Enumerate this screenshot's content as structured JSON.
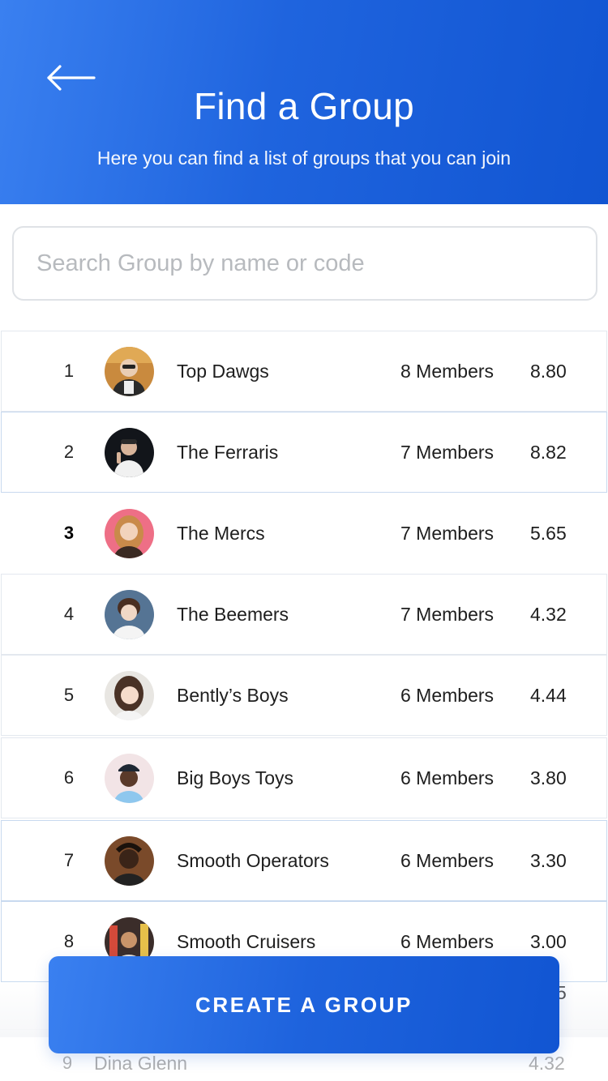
{
  "header": {
    "title": "Find a Group",
    "subtitle": "Here you can find a list of groups that you can join",
    "back_icon": "arrow-left-icon"
  },
  "search": {
    "placeholder": "Search Group by name or code",
    "value": ""
  },
  "groups": [
    {
      "rank": "1",
      "name": "Top Dawgs",
      "members": "8 Members",
      "score": "8.80"
    },
    {
      "rank": "2",
      "name": "The Ferraris",
      "members": "7 Members",
      "score": "8.82"
    },
    {
      "rank": "3",
      "name": "The Mercs",
      "members": "7 Members",
      "score": "5.65"
    },
    {
      "rank": "4",
      "name": "The Beemers",
      "members": "7 Members",
      "score": "4.32"
    },
    {
      "rank": "5",
      "name": "Bently’s Boys",
      "members": "6 Members",
      "score": "4.44"
    },
    {
      "rank": "6",
      "name": "Big Boys Toys",
      "members": "6 Members",
      "score": "3.80"
    },
    {
      "rank": "7",
      "name": "Smooth Operators",
      "members": "6 Members",
      "score": "3.30"
    },
    {
      "rank": "8",
      "name": "Smooth Cruisers",
      "members": "6 Members",
      "score": "3.00"
    }
  ],
  "peek": {
    "partial_score": "5",
    "rank": "9",
    "name": "Dina Glenn",
    "score": "4.32"
  },
  "cta": {
    "label": "CREATE A GROUP"
  },
  "colors": {
    "accent_start": "#3a80f0",
    "accent_end": "#1155d2",
    "row_border": "#e3e8ef"
  }
}
